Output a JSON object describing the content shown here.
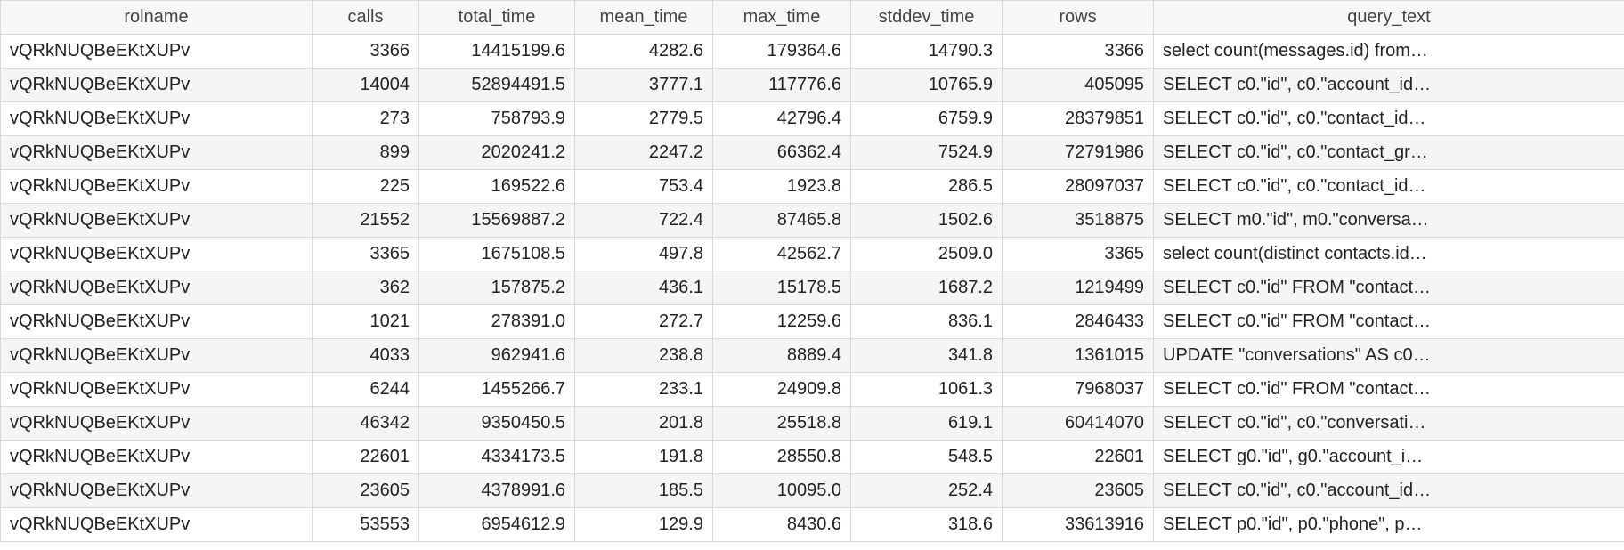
{
  "table": {
    "columns": [
      {
        "key": "rolname",
        "label": "rolname",
        "type": "txt"
      },
      {
        "key": "calls",
        "label": "calls",
        "type": "num"
      },
      {
        "key": "total_time",
        "label": "total_time",
        "type": "num"
      },
      {
        "key": "mean_time",
        "label": "mean_time",
        "type": "num"
      },
      {
        "key": "max_time",
        "label": "max_time",
        "type": "num"
      },
      {
        "key": "stddev_time",
        "label": "stddev_time",
        "type": "num"
      },
      {
        "key": "rows",
        "label": "rows",
        "type": "num"
      },
      {
        "key": "query_text",
        "label": "query_text",
        "type": "txt"
      }
    ],
    "rows": [
      {
        "rolname": "vQRkNUQBeEKtXUPv",
        "calls": "3366",
        "total_time": "14415199.6",
        "mean_time": "4282.6",
        "max_time": "179364.6",
        "stddev_time": "14790.3",
        "rows": "3366",
        "query_text": "select count(messages.id) from…"
      },
      {
        "rolname": "vQRkNUQBeEKtXUPv",
        "calls": "14004",
        "total_time": "52894491.5",
        "mean_time": "3777.1",
        "max_time": "117776.6",
        "stddev_time": "10765.9",
        "rows": "405095",
        "query_text": "SELECT c0.\"id\", c0.\"account_id…"
      },
      {
        "rolname": "vQRkNUQBeEKtXUPv",
        "calls": "273",
        "total_time": "758793.9",
        "mean_time": "2779.5",
        "max_time": "42796.4",
        "stddev_time": "6759.9",
        "rows": "28379851",
        "query_text": "SELECT c0.\"id\", c0.\"contact_id…"
      },
      {
        "rolname": "vQRkNUQBeEKtXUPv",
        "calls": "899",
        "total_time": "2020241.2",
        "mean_time": "2247.2",
        "max_time": "66362.4",
        "stddev_time": "7524.9",
        "rows": "72791986",
        "query_text": "SELECT c0.\"id\", c0.\"contact_gr…"
      },
      {
        "rolname": "vQRkNUQBeEKtXUPv",
        "calls": "225",
        "total_time": "169522.6",
        "mean_time": "753.4",
        "max_time": "1923.8",
        "stddev_time": "286.5",
        "rows": "28097037",
        "query_text": "SELECT c0.\"id\", c0.\"contact_id…"
      },
      {
        "rolname": "vQRkNUQBeEKtXUPv",
        "calls": "21552",
        "total_time": "15569887.2",
        "mean_time": "722.4",
        "max_time": "87465.8",
        "stddev_time": "1502.6",
        "rows": "3518875",
        "query_text": "SELECT m0.\"id\", m0.\"conversa…"
      },
      {
        "rolname": "vQRkNUQBeEKtXUPv",
        "calls": "3365",
        "total_time": "1675108.5",
        "mean_time": "497.8",
        "max_time": "42562.7",
        "stddev_time": "2509.0",
        "rows": "3365",
        "query_text": "select count(distinct contacts.id…"
      },
      {
        "rolname": "vQRkNUQBeEKtXUPv",
        "calls": "362",
        "total_time": "157875.2",
        "mean_time": "436.1",
        "max_time": "15178.5",
        "stddev_time": "1687.2",
        "rows": "1219499",
        "query_text": "SELECT c0.\"id\" FROM \"contact…"
      },
      {
        "rolname": "vQRkNUQBeEKtXUPv",
        "calls": "1021",
        "total_time": "278391.0",
        "mean_time": "272.7",
        "max_time": "12259.6",
        "stddev_time": "836.1",
        "rows": "2846433",
        "query_text": "SELECT c0.\"id\" FROM \"contact…"
      },
      {
        "rolname": "vQRkNUQBeEKtXUPv",
        "calls": "4033",
        "total_time": "962941.6",
        "mean_time": "238.8",
        "max_time": "8889.4",
        "stddev_time": "341.8",
        "rows": "1361015",
        "query_text": "UPDATE \"conversations\" AS c0…"
      },
      {
        "rolname": "vQRkNUQBeEKtXUPv",
        "calls": "6244",
        "total_time": "1455266.7",
        "mean_time": "233.1",
        "max_time": "24909.8",
        "stddev_time": "1061.3",
        "rows": "7968037",
        "query_text": "SELECT c0.\"id\" FROM \"contact…"
      },
      {
        "rolname": "vQRkNUQBeEKtXUPv",
        "calls": "46342",
        "total_time": "9350450.5",
        "mean_time": "201.8",
        "max_time": "25518.8",
        "stddev_time": "619.1",
        "rows": "60414070",
        "query_text": "SELECT c0.\"id\", c0.\"conversati…"
      },
      {
        "rolname": "vQRkNUQBeEKtXUPv",
        "calls": "22601",
        "total_time": "4334173.5",
        "mean_time": "191.8",
        "max_time": "28550.8",
        "stddev_time": "548.5",
        "rows": "22601",
        "query_text": "SELECT g0.\"id\", g0.\"account_i…"
      },
      {
        "rolname": "vQRkNUQBeEKtXUPv",
        "calls": "23605",
        "total_time": "4378991.6",
        "mean_time": "185.5",
        "max_time": "10095.0",
        "stddev_time": "252.4",
        "rows": "23605",
        "query_text": "SELECT c0.\"id\", c0.\"account_id…"
      },
      {
        "rolname": "vQRkNUQBeEKtXUPv",
        "calls": "53553",
        "total_time": "6954612.9",
        "mean_time": "129.9",
        "max_time": "8430.6",
        "stddev_time": "318.6",
        "rows": "33613916",
        "query_text": "SELECT p0.\"id\", p0.\"phone\", p…"
      }
    ]
  }
}
